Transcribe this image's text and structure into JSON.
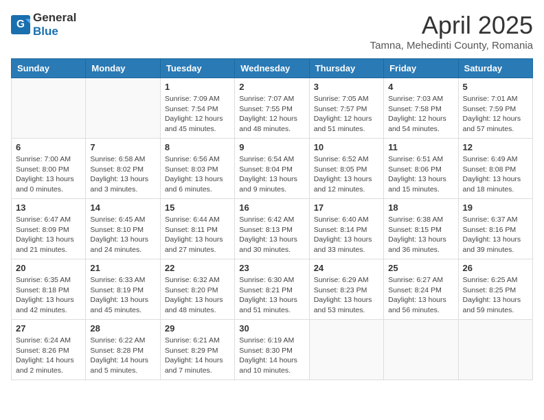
{
  "header": {
    "logo_general": "General",
    "logo_blue": "Blue",
    "month_year": "April 2025",
    "location": "Tamna, Mehedinti County, Romania"
  },
  "weekdays": [
    "Sunday",
    "Monday",
    "Tuesday",
    "Wednesday",
    "Thursday",
    "Friday",
    "Saturday"
  ],
  "weeks": [
    [
      {
        "day": "",
        "detail": ""
      },
      {
        "day": "",
        "detail": ""
      },
      {
        "day": "1",
        "detail": "Sunrise: 7:09 AM\nSunset: 7:54 PM\nDaylight: 12 hours and 45 minutes."
      },
      {
        "day": "2",
        "detail": "Sunrise: 7:07 AM\nSunset: 7:55 PM\nDaylight: 12 hours and 48 minutes."
      },
      {
        "day": "3",
        "detail": "Sunrise: 7:05 AM\nSunset: 7:57 PM\nDaylight: 12 hours and 51 minutes."
      },
      {
        "day": "4",
        "detail": "Sunrise: 7:03 AM\nSunset: 7:58 PM\nDaylight: 12 hours and 54 minutes."
      },
      {
        "day": "5",
        "detail": "Sunrise: 7:01 AM\nSunset: 7:59 PM\nDaylight: 12 hours and 57 minutes."
      }
    ],
    [
      {
        "day": "6",
        "detail": "Sunrise: 7:00 AM\nSunset: 8:00 PM\nDaylight: 13 hours and 0 minutes."
      },
      {
        "day": "7",
        "detail": "Sunrise: 6:58 AM\nSunset: 8:02 PM\nDaylight: 13 hours and 3 minutes."
      },
      {
        "day": "8",
        "detail": "Sunrise: 6:56 AM\nSunset: 8:03 PM\nDaylight: 13 hours and 6 minutes."
      },
      {
        "day": "9",
        "detail": "Sunrise: 6:54 AM\nSunset: 8:04 PM\nDaylight: 13 hours and 9 minutes."
      },
      {
        "day": "10",
        "detail": "Sunrise: 6:52 AM\nSunset: 8:05 PM\nDaylight: 13 hours and 12 minutes."
      },
      {
        "day": "11",
        "detail": "Sunrise: 6:51 AM\nSunset: 8:06 PM\nDaylight: 13 hours and 15 minutes."
      },
      {
        "day": "12",
        "detail": "Sunrise: 6:49 AM\nSunset: 8:08 PM\nDaylight: 13 hours and 18 minutes."
      }
    ],
    [
      {
        "day": "13",
        "detail": "Sunrise: 6:47 AM\nSunset: 8:09 PM\nDaylight: 13 hours and 21 minutes."
      },
      {
        "day": "14",
        "detail": "Sunrise: 6:45 AM\nSunset: 8:10 PM\nDaylight: 13 hours and 24 minutes."
      },
      {
        "day": "15",
        "detail": "Sunrise: 6:44 AM\nSunset: 8:11 PM\nDaylight: 13 hours and 27 minutes."
      },
      {
        "day": "16",
        "detail": "Sunrise: 6:42 AM\nSunset: 8:13 PM\nDaylight: 13 hours and 30 minutes."
      },
      {
        "day": "17",
        "detail": "Sunrise: 6:40 AM\nSunset: 8:14 PM\nDaylight: 13 hours and 33 minutes."
      },
      {
        "day": "18",
        "detail": "Sunrise: 6:38 AM\nSunset: 8:15 PM\nDaylight: 13 hours and 36 minutes."
      },
      {
        "day": "19",
        "detail": "Sunrise: 6:37 AM\nSunset: 8:16 PM\nDaylight: 13 hours and 39 minutes."
      }
    ],
    [
      {
        "day": "20",
        "detail": "Sunrise: 6:35 AM\nSunset: 8:18 PM\nDaylight: 13 hours and 42 minutes."
      },
      {
        "day": "21",
        "detail": "Sunrise: 6:33 AM\nSunset: 8:19 PM\nDaylight: 13 hours and 45 minutes."
      },
      {
        "day": "22",
        "detail": "Sunrise: 6:32 AM\nSunset: 8:20 PM\nDaylight: 13 hours and 48 minutes."
      },
      {
        "day": "23",
        "detail": "Sunrise: 6:30 AM\nSunset: 8:21 PM\nDaylight: 13 hours and 51 minutes."
      },
      {
        "day": "24",
        "detail": "Sunrise: 6:29 AM\nSunset: 8:23 PM\nDaylight: 13 hours and 53 minutes."
      },
      {
        "day": "25",
        "detail": "Sunrise: 6:27 AM\nSunset: 8:24 PM\nDaylight: 13 hours and 56 minutes."
      },
      {
        "day": "26",
        "detail": "Sunrise: 6:25 AM\nSunset: 8:25 PM\nDaylight: 13 hours and 59 minutes."
      }
    ],
    [
      {
        "day": "27",
        "detail": "Sunrise: 6:24 AM\nSunset: 8:26 PM\nDaylight: 14 hours and 2 minutes."
      },
      {
        "day": "28",
        "detail": "Sunrise: 6:22 AM\nSunset: 8:28 PM\nDaylight: 14 hours and 5 minutes."
      },
      {
        "day": "29",
        "detail": "Sunrise: 6:21 AM\nSunset: 8:29 PM\nDaylight: 14 hours and 7 minutes."
      },
      {
        "day": "30",
        "detail": "Sunrise: 6:19 AM\nSunset: 8:30 PM\nDaylight: 14 hours and 10 minutes."
      },
      {
        "day": "",
        "detail": ""
      },
      {
        "day": "",
        "detail": ""
      },
      {
        "day": "",
        "detail": ""
      }
    ]
  ]
}
